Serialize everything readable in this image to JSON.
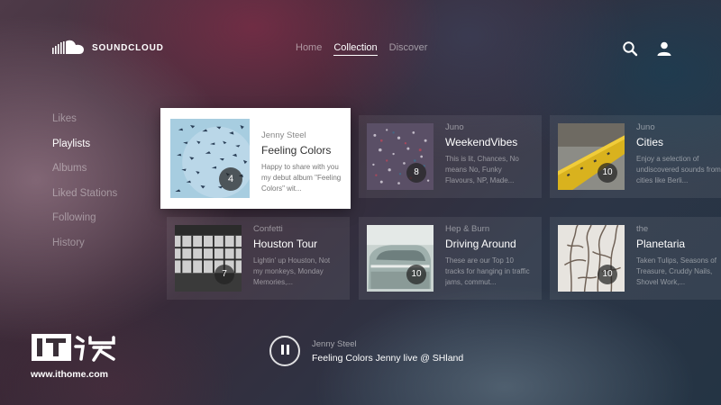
{
  "brand": {
    "name": "SOUNDCLOUD"
  },
  "nav": {
    "items": [
      {
        "label": "Home",
        "active": false
      },
      {
        "label": "Collection",
        "active": true
      },
      {
        "label": "Discover",
        "active": false
      }
    ]
  },
  "header_icons": [
    "search-icon",
    "user-icon"
  ],
  "sidebar": {
    "items": [
      {
        "label": "Likes",
        "active": false
      },
      {
        "label": "Playlists",
        "active": true
      },
      {
        "label": "Albums",
        "active": false
      },
      {
        "label": "Liked Stations",
        "active": false
      },
      {
        "label": "Following",
        "active": false
      },
      {
        "label": "History",
        "active": false
      }
    ]
  },
  "playlists": [
    {
      "artist": "Jenny Steel",
      "title": "Feeling Colors",
      "description": "Happy to share with you my debut album \"Feeling Colors\" wit...",
      "count": "4",
      "selected": true
    },
    {
      "artist": "Juno",
      "title": "WeekendVibes",
      "description": "This is lit, Chances, No means No, Funky Flavours, NP, Made...",
      "count": "8",
      "selected": false
    },
    {
      "artist": "Juno",
      "title": "Cities",
      "description": "Enjoy a selection of undiscovered sounds from cities like Berli...",
      "count": "10",
      "selected": false
    },
    {
      "artist": "Confetti",
      "title": "Houston Tour",
      "description": "Lightin' up Houston, Not my monkeys, Monday Memories,...",
      "count": "7",
      "selected": false
    },
    {
      "artist": "Hep & Burn",
      "title": "Driving Around",
      "description": "These are our Top 10 tracks for hanging in traffic jams, commut...",
      "count": "10",
      "selected": false
    },
    {
      "artist": "the",
      "title": "Planetaria",
      "description": "Taken Tulips, Seasons of Treasure, Cruddy Nails,  Shovel Work,...",
      "count": "10",
      "selected": false
    }
  ],
  "player": {
    "state": "playing",
    "artist": "Jenny Steel",
    "track": "Feeling Colors Jenny live @ SHland"
  },
  "watermark": {
    "site": "www.ithome.com"
  },
  "colors": {
    "accent": "#ffffff",
    "selected_card": "#ffffff",
    "logo_stripe": "#2f2f2f"
  }
}
